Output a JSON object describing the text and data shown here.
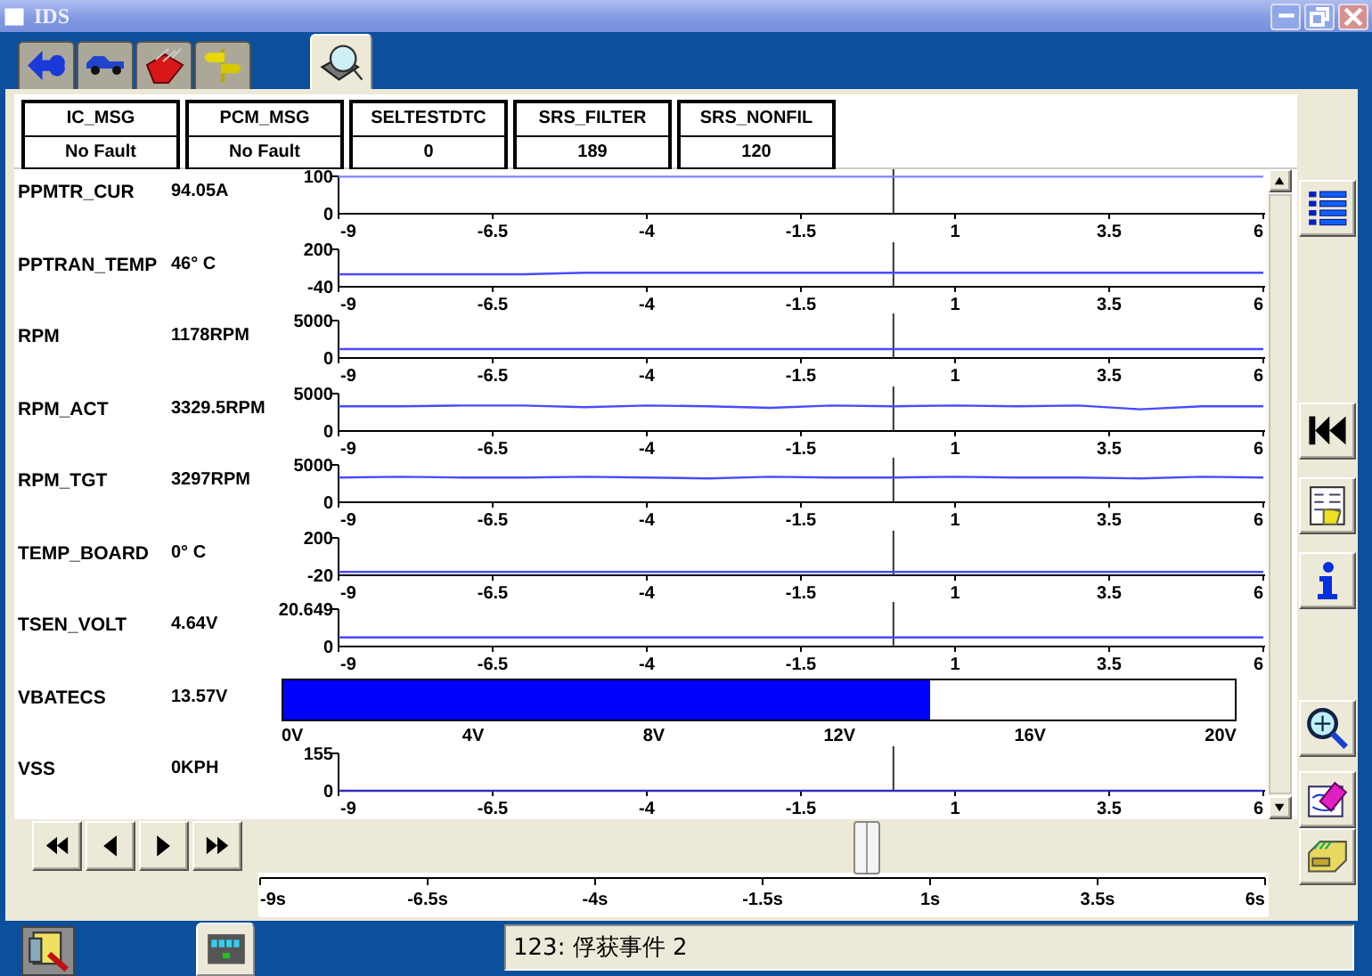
{
  "window": {
    "title": "IDS"
  },
  "tabs": [
    {
      "kind": "connector",
      "selected": false
    },
    {
      "kind": "vehicle",
      "selected": false
    },
    {
      "kind": "toolbox",
      "selected": false
    },
    {
      "kind": "signpost",
      "selected": false
    },
    {
      "kind": "datalogger",
      "selected": true
    }
  ],
  "dtc_monitors": [
    {
      "name": "IC_MSG",
      "value": "No Fault"
    },
    {
      "name": "PCM_MSG",
      "value": "No Fault"
    },
    {
      "name": "SELTESTDTC",
      "value": "0"
    },
    {
      "name": "SRS_FILTER",
      "value": "189"
    },
    {
      "name": "SRS_NONFIL",
      "value": "120"
    }
  ],
  "signals": [
    {
      "kind": "graph",
      "name": "PPMTR_CUR",
      "reading": "94.05A",
      "chart_data": {
        "type": "line",
        "x": [
          -9,
          -8,
          -7,
          -6,
          -5,
          -4,
          -3,
          -2,
          -1,
          0,
          1,
          2,
          3,
          4,
          5,
          6
        ],
        "series": [
          {
            "color": "#8080ff",
            "values": [
              99,
              99,
              99,
              99,
              99,
              99,
              99,
              99,
              99,
              99,
              99,
              99,
              99,
              99,
              99,
              99
            ]
          }
        ],
        "xlim": [
          -9,
          6
        ],
        "ylim": [
          0,
          100
        ],
        "xticks": [
          -9,
          -6.5,
          -4,
          -1.5,
          1,
          3.5,
          6
        ],
        "yticks": [
          0,
          100
        ]
      }
    },
    {
      "kind": "graph",
      "name": "PPTRAN_TEMP",
      "reading": "46°  C",
      "chart_data": {
        "type": "line",
        "x": [
          -9,
          -8,
          -7,
          -6,
          -5,
          -4,
          -3,
          -2,
          -1,
          0,
          1,
          2,
          3,
          4,
          5,
          6
        ],
        "series": [
          {
            "color": "#4a4aff",
            "values": [
              40,
              40,
              40,
              40,
              50,
              50,
              50,
              50,
              50,
              50,
              50,
              50,
              50,
              50,
              50,
              50
            ]
          }
        ],
        "xlim": [
          -9,
          6
        ],
        "ylim": [
          -40,
          200
        ],
        "xticks": [
          -9,
          -6.5,
          -4,
          -1.5,
          1,
          3.5,
          6
        ],
        "yticks": [
          -40,
          200
        ]
      }
    },
    {
      "kind": "graph",
      "name": "RPM",
      "reading": "1178RPM",
      "chart_data": {
        "type": "line",
        "x": [
          -9,
          -8,
          -7,
          -6,
          -5,
          -4,
          -3,
          -2,
          -1,
          0,
          1,
          2,
          3,
          4,
          5,
          6
        ],
        "series": [
          {
            "color": "#4a4aff",
            "values": [
              1200,
              1200,
              1200,
              1200,
              1200,
              1200,
              1200,
              1200,
              1200,
              1200,
              1200,
              1200,
              1200,
              1200,
              1200,
              1200
            ]
          }
        ],
        "xlim": [
          -9,
          6
        ],
        "ylim": [
          0,
          5000
        ],
        "xticks": [
          -9,
          -6.5,
          -4,
          -1.5,
          1,
          3.5,
          6
        ],
        "yticks": [
          0,
          5000
        ]
      }
    },
    {
      "kind": "graph",
      "name": "RPM_ACT",
      "reading": "3329.5RPM",
      "chart_data": {
        "type": "line",
        "x": [
          -9,
          -8,
          -7,
          -6,
          -5,
          -4,
          -3,
          -2,
          -1,
          0,
          1,
          2,
          3,
          4,
          5,
          6
        ],
        "series": [
          {
            "color": "#4a4aff",
            "values": [
              3300,
              3300,
              3400,
              3400,
              3200,
              3400,
              3300,
              3100,
              3400,
              3300,
              3400,
              3300,
              3400,
              2900,
              3300,
              3300
            ]
          }
        ],
        "xlim": [
          -9,
          6
        ],
        "ylim": [
          0,
          5000
        ],
        "xticks": [
          -9,
          -6.5,
          -4,
          -1.5,
          1,
          3.5,
          6
        ],
        "yticks": [
          0,
          5000
        ]
      }
    },
    {
      "kind": "graph",
      "name": "RPM_TGT",
      "reading": "3297RPM",
      "chart_data": {
        "type": "line",
        "x": [
          -9,
          -8,
          -7,
          -6,
          -5,
          -4,
          -3,
          -2,
          -1,
          0,
          1,
          2,
          3,
          4,
          5,
          6
        ],
        "series": [
          {
            "color": "#4a4aff",
            "values": [
              3300,
              3400,
              3300,
              3300,
              3400,
              3300,
              3200,
              3400,
              3300,
              3300,
              3400,
              3300,
              3300,
              3200,
              3400,
              3300
            ]
          }
        ],
        "xlim": [
          -9,
          6
        ],
        "ylim": [
          0,
          5000
        ],
        "xticks": [
          -9,
          -6.5,
          -4,
          -1.5,
          1,
          3.5,
          6
        ],
        "yticks": [
          0,
          5000
        ]
      }
    },
    {
      "kind": "graph",
      "name": "TEMP_BOARD",
      "reading": "0°  C",
      "chart_data": {
        "type": "line",
        "x": [
          -9,
          -8,
          -7,
          -6,
          -5,
          -4,
          -3,
          -2,
          -1,
          0,
          1,
          2,
          3,
          4,
          5,
          6
        ],
        "series": [
          {
            "color": "#4a4aff",
            "values": [
              0,
              0,
              0,
              0,
              0,
              0,
              0,
              0,
              0,
              0,
              0,
              0,
              0,
              0,
              0,
              0
            ]
          }
        ],
        "xlim": [
          -9,
          6
        ],
        "ylim": [
          -20,
          200
        ],
        "xticks": [
          -9,
          -6.5,
          -4,
          -1.5,
          1,
          3.5,
          6
        ],
        "yticks": [
          -20,
          200
        ]
      }
    },
    {
      "kind": "graph",
      "name": "TSEN_VOLT",
      "reading": "4.64V",
      "chart_data": {
        "type": "line",
        "x": [
          -9,
          -8,
          -7,
          -6,
          -5,
          -4,
          -3,
          -2,
          -1,
          0,
          1,
          2,
          3,
          4,
          5,
          6
        ],
        "series": [
          {
            "color": "#4a4aff",
            "values": [
              5,
              5,
              5,
              5,
              5,
              5,
              5,
              5,
              5,
              5,
              5,
              5,
              5,
              5,
              5,
              5
            ]
          }
        ],
        "xlim": [
          -9,
          6
        ],
        "ylim": [
          0,
          20.649
        ],
        "xticks": [
          -9,
          -6.5,
          -4,
          -1.5,
          1,
          3.5,
          6
        ],
        "yticks": [
          0,
          20.649
        ]
      }
    },
    {
      "kind": "gauge",
      "name": "VBATECS",
      "reading": "13.57V",
      "level": 0.68,
      "scale": [
        "0V",
        "4V",
        "8V",
        "12V",
        "16V",
        "20V"
      ]
    },
    {
      "kind": "graph",
      "name": "VSS",
      "reading": "0KPH",
      "chart_data": {
        "type": "line",
        "x": [
          -9,
          -8,
          -7,
          -6,
          -5,
          -4,
          -3,
          -2,
          -1,
          0,
          1,
          2,
          3,
          4,
          5,
          6
        ],
        "series": [
          {
            "color": "#3030c0",
            "values": [
              0,
              0,
              0,
              0,
              0,
              0,
              0,
              0,
              0,
              0,
              0,
              0,
              0,
              0,
              0,
              0
            ]
          }
        ],
        "xlim": [
          -9,
          6
        ],
        "ylim": [
          0,
          155
        ],
        "xticks": [
          -9,
          -6.5,
          -4,
          -1.5,
          1,
          3.5,
          6
        ],
        "yticks": [
          0,
          155
        ]
      }
    }
  ],
  "playback": {
    "buttons": [
      {
        "kind": "rewind"
      },
      {
        "kind": "back"
      },
      {
        "kind": "forward"
      },
      {
        "kind": "fast-forward"
      }
    ],
    "timeline": {
      "level": 0.6,
      "ticks": [
        "-9s",
        "-6.5s",
        "-4s",
        "-1.5s",
        "1s",
        "3.5s",
        "6s"
      ]
    }
  },
  "toolbar": [
    {
      "kind": "list"
    },
    {
      "kind": "skip-back"
    },
    {
      "kind": "form"
    },
    {
      "kind": "info"
    },
    {
      "kind": "zoom"
    },
    {
      "kind": "eraser"
    },
    {
      "kind": "drawer"
    }
  ],
  "taskbar": [
    {
      "kind": "inspect",
      "selected": false
    },
    {
      "kind": "filmstrip",
      "selected": true
    }
  ],
  "status": "123: 俘获事件 2"
}
